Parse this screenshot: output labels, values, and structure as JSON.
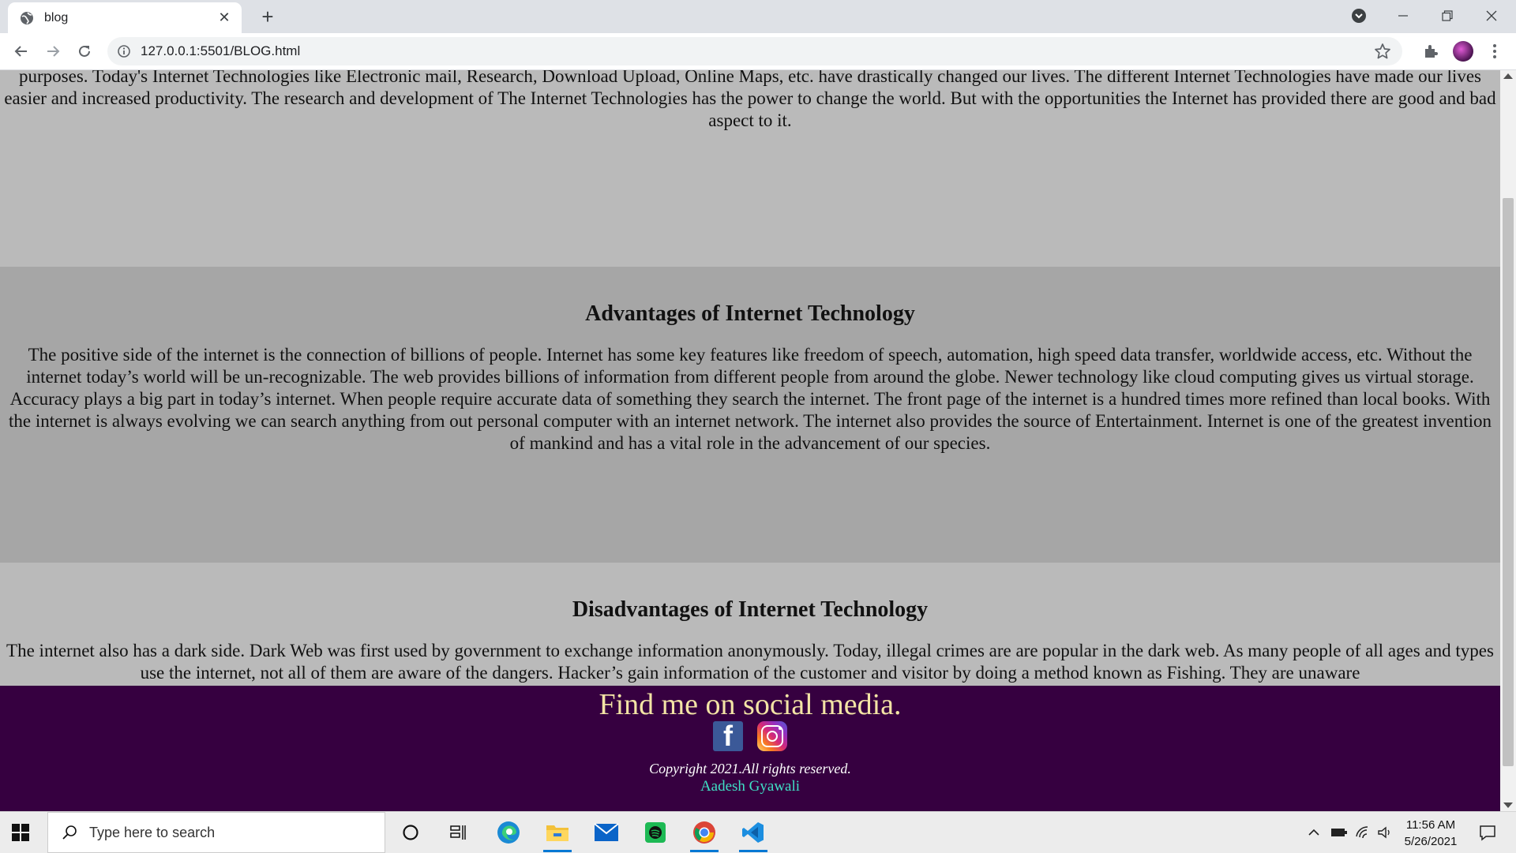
{
  "browser": {
    "tab_title": "blog",
    "url": "127.0.0.1:5501/BLOG.html",
    "tab_close_glyph": "✕",
    "new_tab_glyph": "+"
  },
  "content": {
    "intro_text": "purposes. Today's Internet Technologies like Electronic mail, Research, Download Upload, Online Maps, etc. have drastically changed our lives. The different Internet Technologies have made our lives easier and increased productivity. The research and development of The Internet Technologies has the power to change the world. But with the opportunities the Internet has provided there are good and bad aspect to it.",
    "advantages": {
      "heading": "Advantages of Internet Technology",
      "text": "The positive side of the internet is the connection of billions of people. Internet has some key features like freedom of speech, automation, high speed data transfer, worldwide access, etc. Without the internet today’s world will be un-recognizable. The web provides billions of information from different people from around the globe. Newer technology like cloud computing gives us virtual storage. Accuracy plays a big part in today’s internet. When people require accurate data of something they search the internet. The front page of the internet is a hundred times more refined than local books. With the internet is always evolving we can search anything from out personal computer with an internet network. The internet also provides the source of Entertainment. Internet is one of the greatest invention of mankind and has a vital role in the advancement of our species."
    },
    "disadvantages": {
      "heading": "Disadvantages of Internet Technology",
      "text": "The internet also has a dark side. Dark Web was first used by government to exchange information anonymously. Today, illegal crimes are are popular in the dark web. As many people of all ages and types use the internet, not all of them are aware of the dangers. Hacker’s gain information of the customer and visitor by doing a method known as Fishing. They are unaware"
    }
  },
  "footer": {
    "heading": "Find me on social media.",
    "facebook_glyph": "f",
    "copyright": "Copyright 2021.All rights reserved.",
    "author": "Aadesh Gyawali"
  },
  "taskbar": {
    "search_placeholder": "Type here to search",
    "time": "11:56 AM",
    "date": "5/26/2021"
  },
  "colors": {
    "footer_bg": "#360040",
    "footer_heading": "#f3e4a5",
    "author_link": "#3fe0c5",
    "advantages_bg": "#a6a6a6",
    "page_bg": "#bababa"
  }
}
